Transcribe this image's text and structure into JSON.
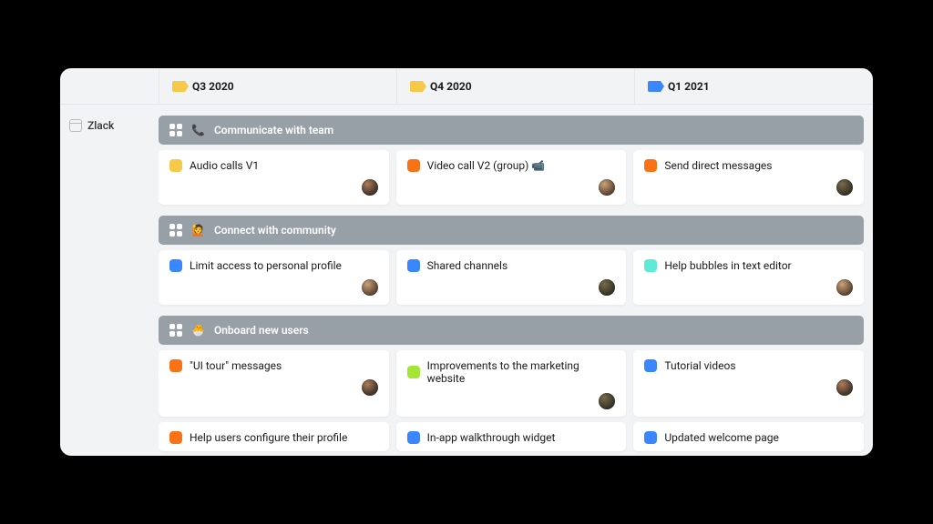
{
  "sidebar": {
    "project_name": "Zlack"
  },
  "columns": [
    {
      "label": "Q3 2020",
      "flag_color": "#f7c948"
    },
    {
      "label": "Q4 2020",
      "flag_color": "#f7c948"
    },
    {
      "label": "Q1 2021",
      "flag_color": "#3a86ff"
    }
  ],
  "groups": [
    {
      "emoji": "📞",
      "title": "Communicate with team",
      "rows": [
        [
          {
            "tag_color": "#f7c948",
            "title": "Audio calls V1",
            "avatar": "alt1"
          },
          {
            "tag_color": "#f97316",
            "title": "Video call V2 (group)",
            "trailing_emoji": "📹",
            "avatar": "alt2"
          },
          {
            "tag_color": "#f97316",
            "title": "Send direct messages",
            "avatar": "alt3"
          }
        ]
      ]
    },
    {
      "emoji": "🙋",
      "title": "Connect with community",
      "rows": [
        [
          {
            "tag_color": "#3a86ff",
            "title": "Limit access to personal profile",
            "avatar": "alt2"
          },
          {
            "tag_color": "#3a86ff",
            "title": "Shared channels",
            "avatar": "alt3"
          },
          {
            "tag_color": "#5eead4",
            "title": "Help bubbles in text editor",
            "avatar": "alt2"
          }
        ]
      ]
    },
    {
      "emoji": "🐣",
      "title": "Onboard new users",
      "rows": [
        [
          {
            "tag_color": "#f97316",
            "title": "\"UI tour\" messages",
            "avatar": "alt1"
          },
          {
            "tag_color": "#a3e635",
            "title": "Improvements to the marketing website",
            "avatar": "alt3"
          },
          {
            "tag_color": "#3a86ff",
            "title": "Tutorial videos",
            "avatar": "alt1"
          }
        ],
        [
          {
            "tag_color": "#f97316",
            "title": "Help users configure their profile",
            "avatar": "alt2"
          },
          {
            "tag_color": "#3a86ff",
            "title": "In-app walkthrough widget",
            "avatar": "alt3"
          },
          {
            "tag_color": "#3a86ff",
            "title": "Updated welcome page",
            "avatar": "alt1"
          }
        ]
      ]
    }
  ]
}
